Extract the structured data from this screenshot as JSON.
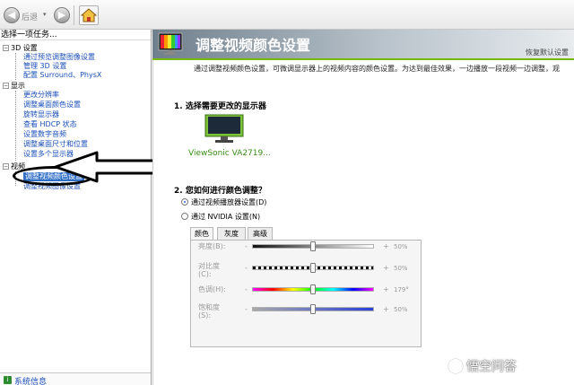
{
  "toolbar": {
    "back_label": "后退",
    "back_dropdown": "▾",
    "home_icon": "home-icon"
  },
  "tree": {
    "header": "选择一项任务...",
    "sections": [
      {
        "label": "3D 设置",
        "items": [
          "通过预览调整图像设置",
          "管理 3D 设置",
          "配置 Surround、PhysX"
        ]
      },
      {
        "label": "显示",
        "items": [
          "更改分辨率",
          "调整桌面颜色设置",
          "旋转显示器",
          "查看 HDCP 状态",
          "设置数字音频",
          "调整桌面尺寸和位置",
          "设置多个显示器"
        ]
      },
      {
        "label": "视频",
        "items": [
          "调整视频颜色设置",
          "调整视频图像设置"
        ]
      }
    ],
    "selected": "调整视频颜色设置",
    "footer_link": "系统信息"
  },
  "page": {
    "title": "调整视频颜色设置",
    "restore_defaults": "恢复默认设置",
    "description": "通过调整视频颜色设置，可微调显示器上的视频内容的颜色设置。为达到最佳效果，一边播放一段视频一边调整，观",
    "section1_title": "1. 选择需要更改的显示器",
    "monitor_label": "ViewSonic VA2719...",
    "section2_title": "2. 您如何进行颜色调整？",
    "radio1": "通过视频播放器设置(D)",
    "radio2": "通过 NVIDIA 设置(N)",
    "radio_selected": 1,
    "tabs": [
      "颜色",
      "灰度",
      "高级"
    ],
    "active_tab": 0,
    "sliders": [
      {
        "label": "亮度(B):",
        "minus": "-",
        "plus": "+",
        "value": "50%",
        "level": 0.5
      },
      {
        "label": "对比度\n(C):",
        "minus": "-",
        "plus": "+",
        "value": "50%",
        "level": 0.5
      },
      {
        "label": "色调(H):",
        "minus": "-",
        "plus": "+",
        "value": "179°",
        "level": 0.5
      },
      {
        "label": "饱和度\n(S):",
        "minus": "-",
        "plus": "+",
        "value": "50%",
        "level": 0.5
      }
    ]
  },
  "watermark": "悟空问答",
  "colors": {
    "nvidia_green": "#76b900",
    "link_blue": "#1a4fb8",
    "selected_bg": "#3270c8"
  }
}
